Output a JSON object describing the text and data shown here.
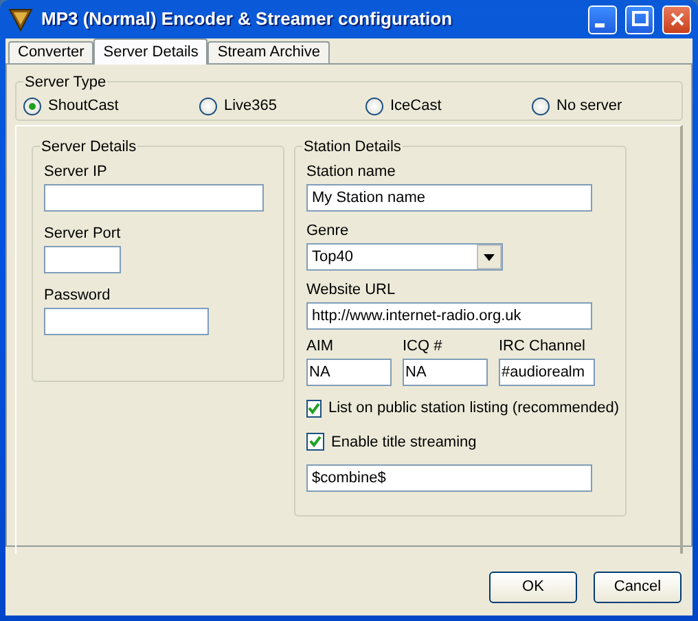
{
  "window": {
    "title": "MP3 (Normal) Encoder & Streamer configuration"
  },
  "tabs": [
    {
      "label": "Converter",
      "selected": false
    },
    {
      "label": "Server Details",
      "selected": true
    },
    {
      "label": "Stream Archive",
      "selected": false
    }
  ],
  "server_type": {
    "title": "Server Type",
    "options": [
      {
        "label": "ShoutCast",
        "selected": true
      },
      {
        "label": "Live365",
        "selected": false
      },
      {
        "label": "IceCast",
        "selected": false
      },
      {
        "label": "No server",
        "selected": false
      }
    ]
  },
  "server_details": {
    "title": "Server Details",
    "fields": [
      {
        "label": "Server IP"
      },
      {
        "label": "Server Port"
      },
      {
        "label": "Password"
      }
    ]
  },
  "station_details": {
    "title": "Station Details",
    "station_name": {
      "label": "Station name",
      "value": "My Station name"
    },
    "genre": {
      "label": "Genre",
      "value": "Top40"
    },
    "website_url": {
      "label": "Website URL",
      "value": "http://www.internet-radio.org.uk"
    },
    "contacts": [
      {
        "label": "AIM",
        "value": "NA"
      },
      {
        "label": "ICQ #",
        "value": "NA"
      },
      {
        "label": "IRC Channel",
        "value": "#audiorealm"
      }
    ],
    "options": [
      {
        "label": "List on public station listing (recommended)",
        "checked": true
      },
      {
        "label": "Enable title streaming",
        "checked": true
      }
    ],
    "title_format": "$combine$"
  },
  "buttons": [
    "OK",
    "Cancel"
  ]
}
